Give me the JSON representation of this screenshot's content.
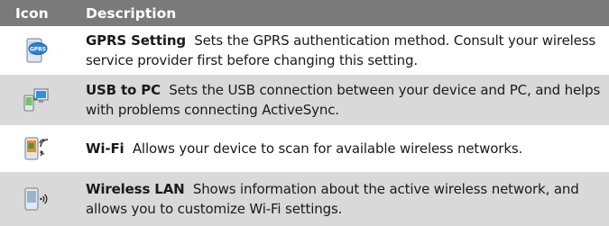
{
  "header": {
    "icon_col": "Icon",
    "description_col": "Description"
  },
  "rows": [
    {
      "icon": "gprs-setting-icon",
      "title": "GPRS Setting",
      "text": "Sets the GPRS authentication method. Consult your wireless service provider first before changing this setting.",
      "icon_label": "GPRS"
    },
    {
      "icon": "usb-to-pc-icon",
      "title": "USB to PC",
      "text": "Sets the USB connection between your device and PC, and helps with problems connecting ActiveSync."
    },
    {
      "icon": "wifi-icon",
      "title": "Wi-Fi",
      "text": "Allows your device to scan for available wireless networks."
    },
    {
      "icon": "wireless-lan-icon",
      "title": "Wireless LAN",
      "text": "Shows information about the active wireless network, and allows you to customize Wi-Fi settings."
    }
  ],
  "colors": {
    "header_bg": "#7a7a7a",
    "alt_row_bg": "#d9d9d9"
  }
}
